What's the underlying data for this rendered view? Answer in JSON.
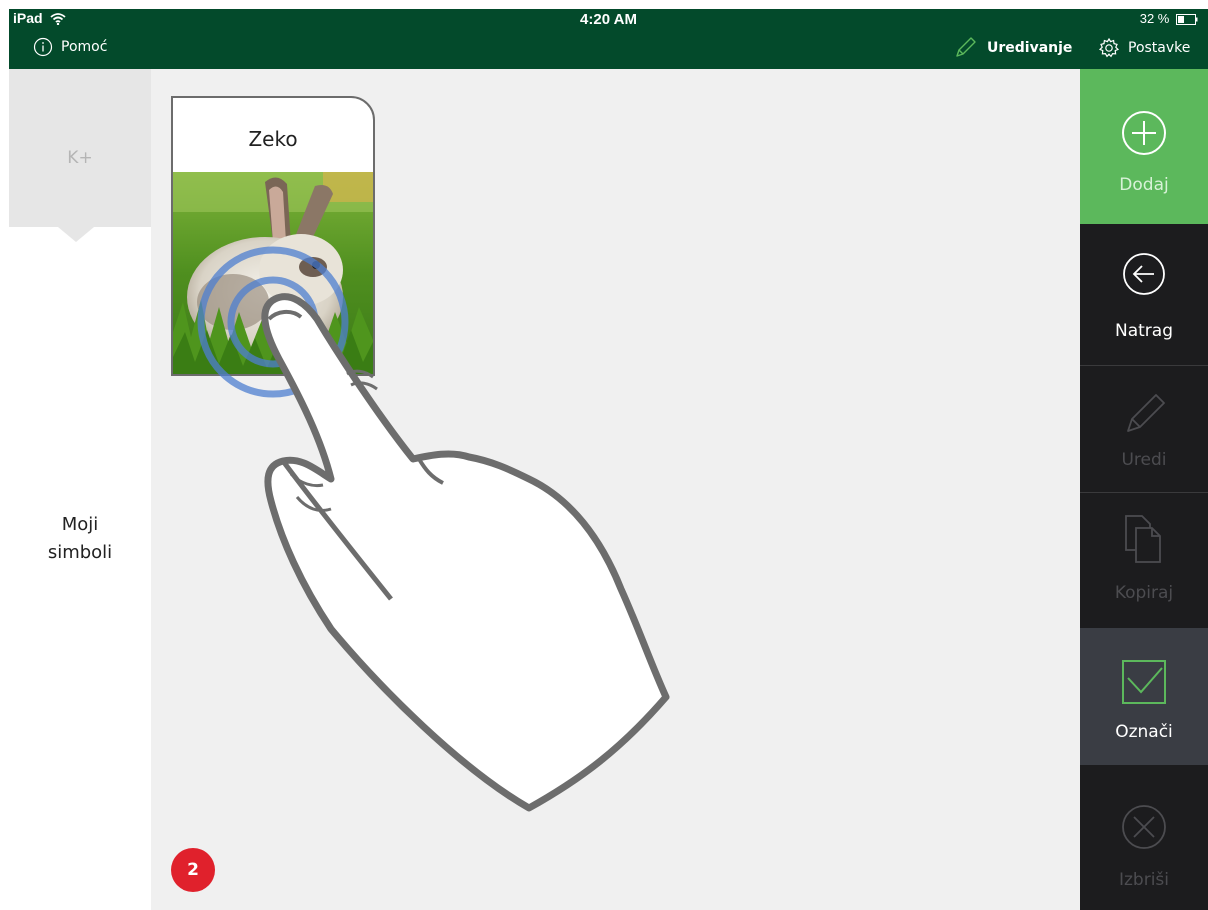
{
  "status_bar": {
    "device": "iPad",
    "time": "4:20 AM",
    "battery": "32 %"
  },
  "header": {
    "help_label": "Pomoć",
    "edit_mode_label": "Uredivanje",
    "settings_label": "Postavke"
  },
  "left_panel": {
    "tab_label": "K+",
    "category_line1": "Moji",
    "category_line2": "simboli"
  },
  "grid": {
    "cards": [
      {
        "title": "Zeko",
        "image": "rabbit-photo"
      }
    ],
    "page_badge": "2"
  },
  "toolbar": {
    "add": "Dodaj",
    "back": "Natrag",
    "edit": "Uredi",
    "copy": "Kopiraj",
    "mark": "Označi",
    "delete": "Izbriši"
  },
  "colors": {
    "header_bg": "#034a2b",
    "add_green": "#5cb85c",
    "toolbar_bg": "#1c1c1e",
    "badge_red": "#e0212c",
    "mark_check": "#5cb85c"
  }
}
